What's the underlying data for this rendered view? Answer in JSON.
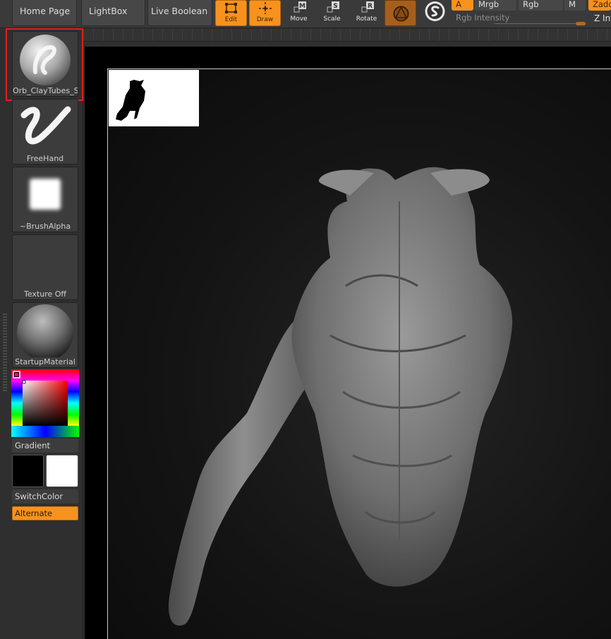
{
  "topbar": {
    "nav_buttons": [
      "Home Page",
      "LightBox",
      "Live Boolean"
    ],
    "tools": [
      {
        "label": "Edit",
        "icon": "edit-icon",
        "active": true
      },
      {
        "label": "Draw",
        "icon": "draw-icon",
        "active": true
      },
      {
        "label": "Move",
        "icon": "move-icon",
        "active": false
      },
      {
        "label": "Scale",
        "icon": "scale-icon",
        "active": false
      },
      {
        "label": "Rotate",
        "icon": "rotate-icon",
        "active": false
      }
    ],
    "color_modes": {
      "a": "A",
      "mrgb": "Mrgb",
      "rgb": "Rgb",
      "m": "M",
      "zadd": "Zadd"
    },
    "rgb_intensity_label": "Rgb Intensity",
    "z_intensity_label": "Z Int"
  },
  "shelf": {
    "brush": {
      "label": "Orb_ClayTubes_S",
      "icon": "claytubes-brush-icon",
      "selected": true
    },
    "stroke": {
      "label": "FreeHand",
      "icon": "freehand-stroke-icon"
    },
    "alpha": {
      "label": "~BrushAlpha",
      "icon": "brush-alpha-icon"
    },
    "texture": {
      "label": "Texture Off"
    },
    "material": {
      "label": "StartupMaterial",
      "icon": "material-sphere-icon"
    },
    "gradient_label": "Gradient",
    "main_color": "#000000",
    "secondary_color": "#ffffff",
    "switch_color_label": "SwitchColor",
    "alternate_label": "Alternate"
  },
  "colors": {
    "accent": "#f7921e",
    "selection_frame": "#e41d1d",
    "background": "#303030",
    "canvas": "#000000"
  }
}
